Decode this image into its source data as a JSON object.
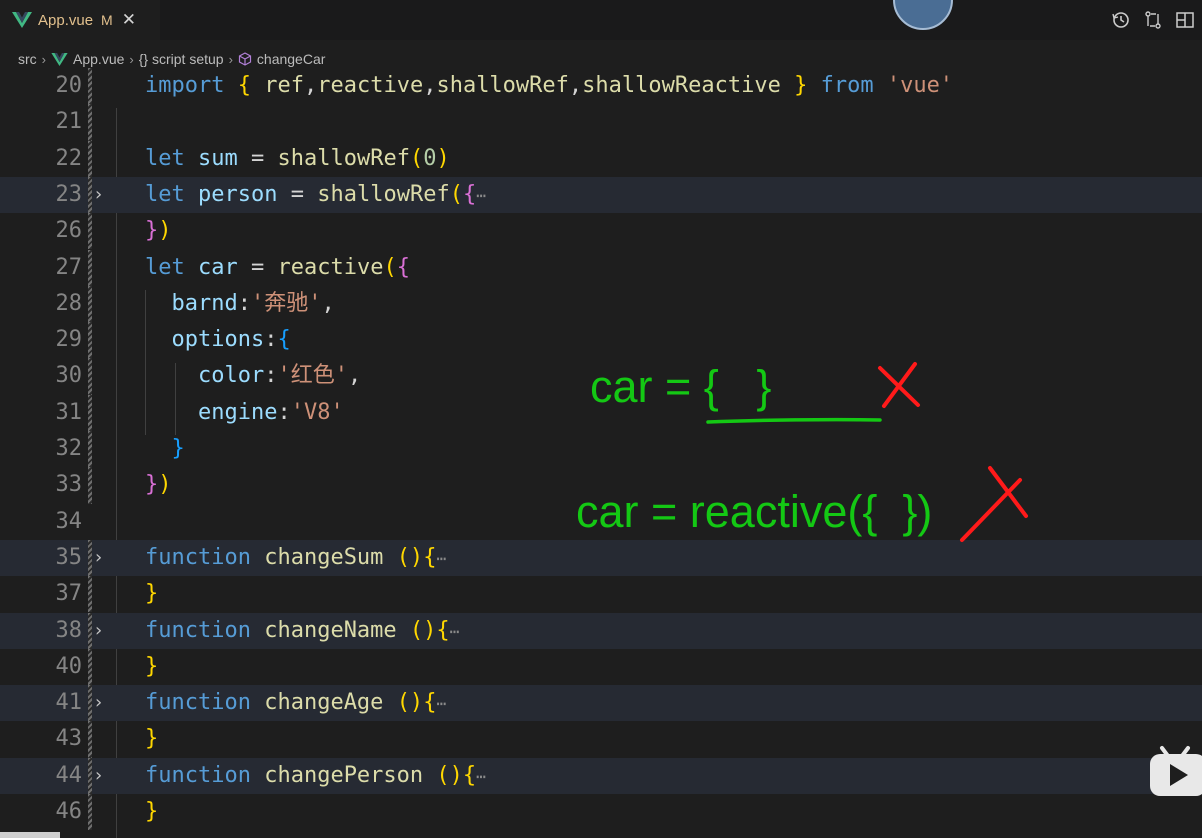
{
  "tab": {
    "filename": "App.vue",
    "modified_badge": "M",
    "close_glyph": "✕"
  },
  "header_actions": [
    "history-icon",
    "compare-changes-icon",
    "split-editor-icon"
  ],
  "breadcrumb": {
    "items": [
      "src",
      "App.vue",
      "{} script setup",
      "changeCar"
    ],
    "separator": "›"
  },
  "editor": {
    "lines": [
      {
        "n": "20"
      },
      {
        "n": "21"
      },
      {
        "n": "22"
      },
      {
        "n": "23"
      },
      {
        "n": "26"
      },
      {
        "n": "27"
      },
      {
        "n": "28"
      },
      {
        "n": "29"
      },
      {
        "n": "30"
      },
      {
        "n": "31"
      },
      {
        "n": "32"
      },
      {
        "n": "33"
      },
      {
        "n": "34"
      },
      {
        "n": "35"
      },
      {
        "n": "37"
      },
      {
        "n": "38"
      },
      {
        "n": "40"
      },
      {
        "n": "41"
      },
      {
        "n": "43"
      },
      {
        "n": "44"
      },
      {
        "n": "46"
      }
    ],
    "code": {
      "import_kw": "import",
      "ref": "ref",
      "reactive": "reactive",
      "shallowRef": "shallowRef",
      "shallowReactive": "shallowReactive",
      "from_kw": "from",
      "vue_str": "'vue'",
      "let_kw": "let",
      "sum": "sum",
      "person": "person",
      "car": "car",
      "zero": "0",
      "barnd": "barnd",
      "benz": "'奔驰'",
      "options": "options",
      "color": "color",
      "red": "'红色'",
      "engine": "engine",
      "v8": "'V8'",
      "function_kw": "function",
      "changeSum": "changeSum",
      "changeName": "changeName",
      "changeAge": "changeAge",
      "changePerson": "changePerson",
      "ellipsis": "⋯"
    }
  },
  "annotations": {
    "line1_prefix": "car = ",
    "line1_braces": "{   }",
    "line2": "car = reactive({  })"
  },
  "colors": {
    "annotation_green": "#14c814",
    "annotation_red": "#ff1a1a",
    "vue_green": "#41b883"
  }
}
